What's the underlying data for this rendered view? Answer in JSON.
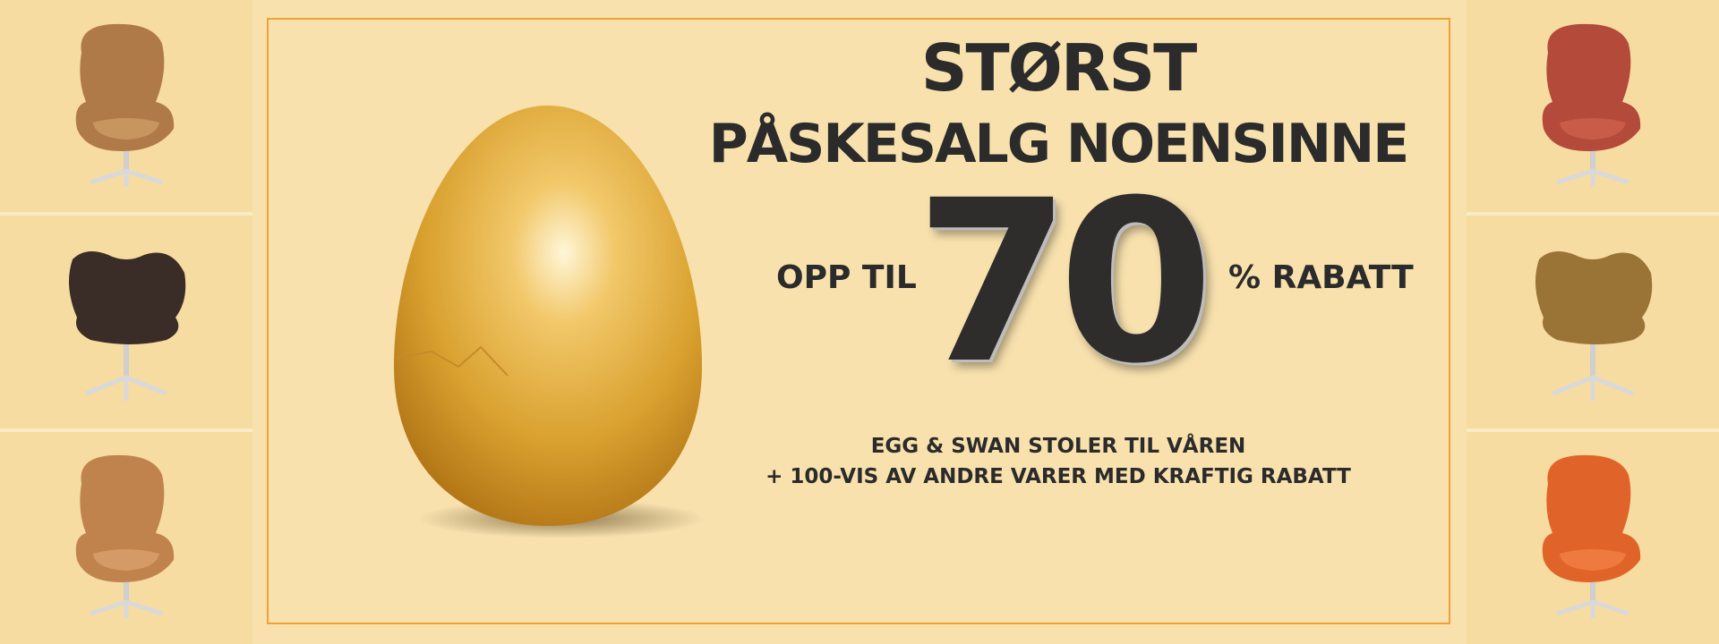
{
  "headline": {
    "line1": "STØRST",
    "line2": "PÅSKESALG NOENSINNE"
  },
  "discount": {
    "prefix": "OPP TIL",
    "value": "70",
    "suffix": "% RABATT"
  },
  "subline": {
    "line1": "EGG & SWAN STOLER TIL VÅREN",
    "line2": "+ 100-VIS AV ANDRE VARER MED KRAFTIG RABATT"
  },
  "colors": {
    "background": "#f6e0a8",
    "frame_border": "#f1a133",
    "text": "#2b2b2b",
    "egg_gold": "#d9a12f"
  },
  "chairs": {
    "left": [
      {
        "type": "egg-chair-icon",
        "color": "#b07a48"
      },
      {
        "type": "swan-chair-icon",
        "color": "#3a2c26"
      },
      {
        "type": "egg-chair-icon",
        "color": "#c0834e"
      }
    ],
    "right": [
      {
        "type": "egg-chair-icon",
        "color": "#b34a3a"
      },
      {
        "type": "swan-chair-icon",
        "color": "#9a7336"
      },
      {
        "type": "egg-chair-icon",
        "color": "#e0642a"
      }
    ]
  }
}
